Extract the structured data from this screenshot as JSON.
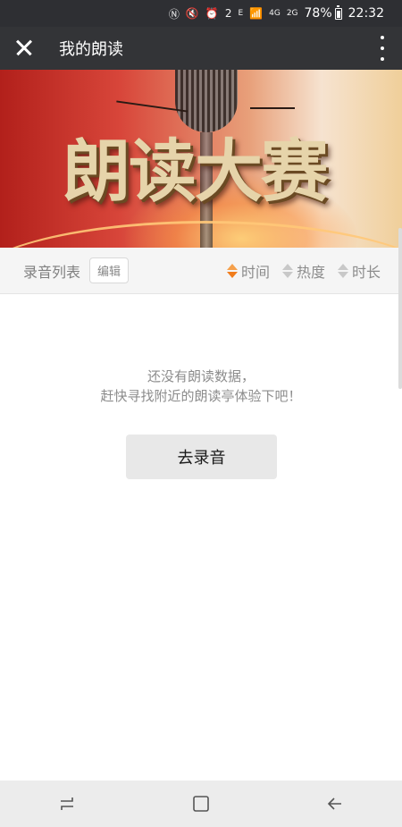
{
  "status_bar": {
    "battery_percent": "78%",
    "time": "22:32",
    "network_4g": "4G",
    "network_2g": "2G",
    "notification_badge": "2",
    "signal_e": "E"
  },
  "title_bar": {
    "title": "我的朗读",
    "close_icon": "close-icon",
    "more_icon": "more-vertical-icon"
  },
  "banner": {
    "title": "朗读大赛",
    "colors": {
      "left": "#b2201b",
      "mid": "#e8a07a",
      "right": "#f0cf9a"
    }
  },
  "filter_bar": {
    "list_label": "录音列表",
    "edit_label": "编辑",
    "sort_options": [
      {
        "label": "时间",
        "active": true
      },
      {
        "label": "热度",
        "active": false
      },
      {
        "label": "时长",
        "active": false
      }
    ],
    "active_color": "#f07c1c"
  },
  "empty_state": {
    "line1": "还没有朗读数据，",
    "line2": "赶快寻找附近的朗读亭体验下吧！",
    "button_label": "去录音"
  },
  "nav_bar": {
    "icons": [
      "recent-apps-icon",
      "home-icon",
      "back-icon"
    ]
  }
}
